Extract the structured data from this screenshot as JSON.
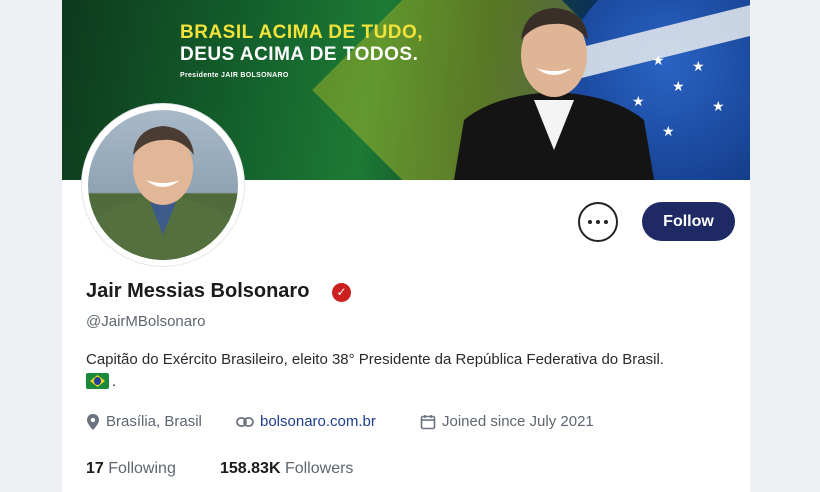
{
  "banner": {
    "slogan_line1": "BRASIL ACIMA DE TUDO,",
    "slogan_line2": "DEUS ACIMA DE TODOS.",
    "slogan_line3": "Presidente JAIR BOLSONARO"
  },
  "profile": {
    "name": "Jair Messias Bolsonaro",
    "handle": "@JairMBolsonaro",
    "bio": "Capitão do Exército Brasileiro, eleito 38° Presidente da República Federativa do Brasil.",
    "bio_suffix": ".",
    "location": "Brasília, Brasil",
    "website": "bolsonaro.com.br",
    "joined": "Joined since July 2021",
    "following_count": "17",
    "following_label": "Following",
    "followers_count": "158.83K",
    "followers_label": "Followers"
  },
  "actions": {
    "follow_label": "Follow"
  },
  "colors": {
    "follow_button": "#1f2a64",
    "verified_badge": "#cc1f1f",
    "link": "#1f3f8c"
  }
}
